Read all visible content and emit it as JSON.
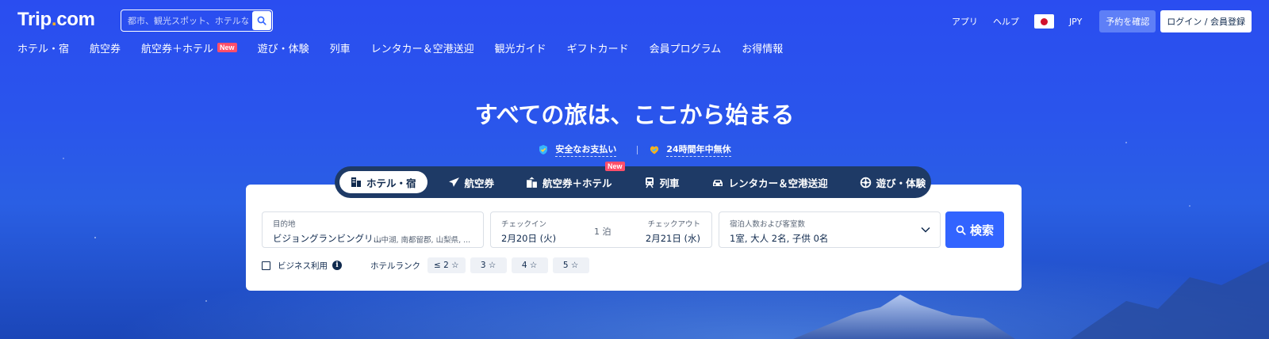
{
  "header": {
    "logo_text": "Trip",
    "logo_dot": ".",
    "logo_suffix": "com",
    "search_placeholder": "都市、観光スポット、ホテルなど",
    "right_nav": {
      "app": "アプリ",
      "help": "ヘルプ",
      "currency": "JPY",
      "reserve_button": "予約を確認",
      "login_button": "ログイン / 会員登録"
    }
  },
  "main_nav": [
    {
      "label": "ホテル・宿"
    },
    {
      "label": "航空券"
    },
    {
      "label": "航空券＋ホテル",
      "badge": "New"
    },
    {
      "label": "遊び・体験"
    },
    {
      "label": "列車"
    },
    {
      "label": "レンタカー＆空港送迎"
    },
    {
      "label": "観光ガイド"
    },
    {
      "label": "ギフトカード"
    },
    {
      "label": "会員プログラム"
    },
    {
      "label": "お得情報"
    }
  ],
  "hero": {
    "title": "すべての旅は、ここから始まる",
    "trust": [
      "安全なお支払い",
      "24時間年中無休"
    ]
  },
  "tabs": [
    {
      "label": "ホテル・宿",
      "active": true,
      "icon": "hotel-icon"
    },
    {
      "label": "航空券",
      "icon": "airplane-icon"
    },
    {
      "label": "航空券＋ホテル",
      "icon": "flight-hotel-icon",
      "badge": "New"
    },
    {
      "label": "列車",
      "icon": "train-icon"
    },
    {
      "label": "レンタカー＆空港送迎",
      "icon": "car-icon"
    },
    {
      "label": "遊び・体験",
      "icon": "attraction-icon"
    }
  ],
  "search_form": {
    "destination_label": "目的地",
    "destination_value": "ビジョングランビングリ...",
    "destination_sub": "山中湖, 南都留郡, 山梨県, ...",
    "checkin_label": "チェックイン",
    "checkin_value": "2月20日 (火)",
    "nights": "1 泊",
    "checkout_label": "チェックアウト",
    "checkout_value": "2月21日 (水)",
    "guests_label": "宿泊人数および客室数",
    "guests_value": "1室, 大人 2名, 子供 0名",
    "search_button": "検索",
    "business_label": "ビジネス利用",
    "hotel_rank_label": "ホテルランク",
    "star_options": [
      "≤ 2 ☆",
      "3 ☆",
      "4 ☆",
      "5 ☆"
    ]
  },
  "colors": {
    "primary_blue": "#3264ff",
    "background": "#2a55ec",
    "tab_bar": "#1e3a66",
    "badge_new": "#ff4e6a",
    "text_dark": "#0f294d"
  }
}
